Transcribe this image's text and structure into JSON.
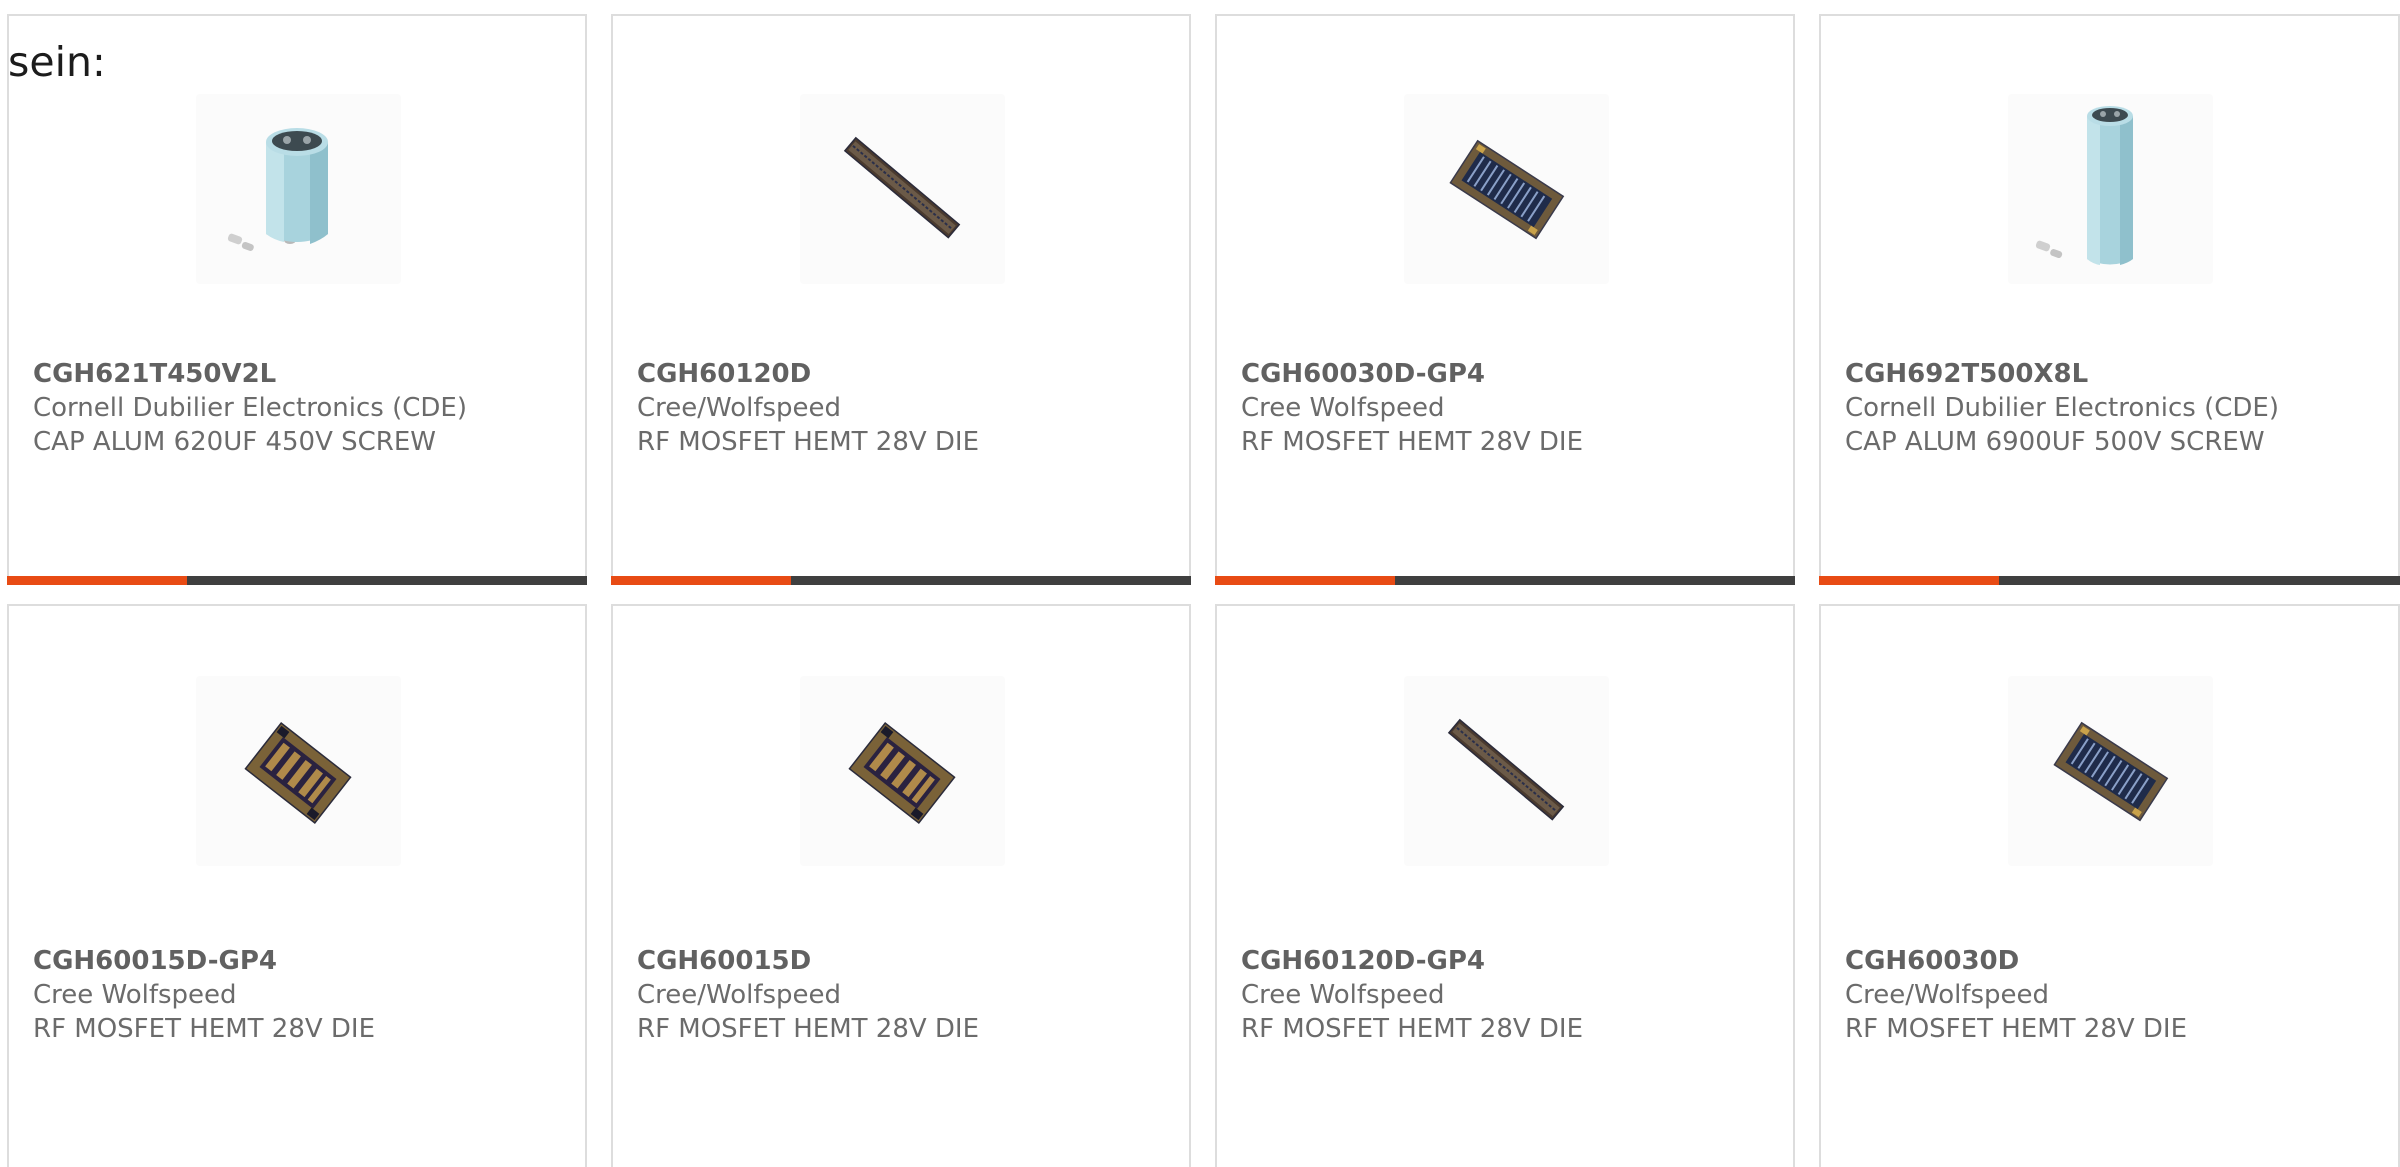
{
  "lead_text": "sein:",
  "accent_color": "#e84b14",
  "bar_color": "#3f3f3f",
  "products": [
    {
      "part_number": "CGH621T450V2L",
      "manufacturer": "Cornell Dubilier Electronics (CDE)",
      "description": "CAP ALUM 620UF 450V SCREW",
      "image_icon": "capacitor-icon",
      "progress": 0.31
    },
    {
      "part_number": "CGH60120D",
      "manufacturer": "Cree/Wolfspeed",
      "description": "RF MOSFET HEMT 28V DIE",
      "image_icon": "die-strip-icon",
      "progress": 0.31
    },
    {
      "part_number": "CGH60030D-GP4",
      "manufacturer": "Cree Wolfspeed",
      "description": "RF MOSFET HEMT 28V DIE",
      "image_icon": "die-chip-icon",
      "progress": 0.31
    },
    {
      "part_number": "CGH692T500X8L",
      "manufacturer": "Cornell Dubilier Electronics (CDE)",
      "description": "CAP ALUM 6900UF 500V SCREW",
      "image_icon": "capacitor-tall-icon",
      "progress": 0.31
    },
    {
      "part_number": "CGH60015D-GP4",
      "manufacturer": "Cree Wolfspeed",
      "description": "RF MOSFET HEMT 28V DIE",
      "image_icon": "die-square-icon"
    },
    {
      "part_number": "CGH60015D",
      "manufacturer": "Cree/Wolfspeed",
      "description": "RF MOSFET HEMT 28V DIE",
      "image_icon": "die-square-icon"
    },
    {
      "part_number": "CGH60120D-GP4",
      "manufacturer": "Cree Wolfspeed",
      "description": "RF MOSFET HEMT 28V DIE",
      "image_icon": "die-strip-icon"
    },
    {
      "part_number": "CGH60030D",
      "manufacturer": "Cree/Wolfspeed",
      "description": "RF MOSFET HEMT 28V DIE",
      "image_icon": "die-chip-icon"
    }
  ]
}
